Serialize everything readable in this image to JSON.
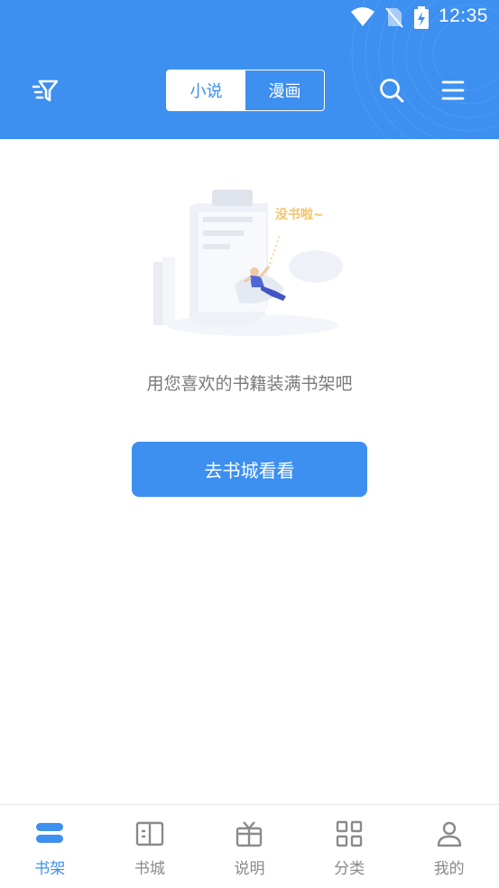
{
  "status_bar": {
    "time": "12:35",
    "icons": [
      "wifi-icon",
      "no-sim-icon",
      "battery-charging-icon"
    ]
  },
  "header": {
    "filter_icon": "filter-icon",
    "tabs": [
      {
        "label": "小说",
        "active": true
      },
      {
        "label": "漫画",
        "active": false
      }
    ],
    "search_icon": "search-icon",
    "menu_icon": "menu-icon"
  },
  "empty_state": {
    "illustration_caption": "没书啦~",
    "message": "用您喜欢的书籍装满书架吧",
    "button_label": "去书城看看"
  },
  "bottom_nav": {
    "items": [
      {
        "label": "书架",
        "icon": "bookshelf-icon",
        "active": true
      },
      {
        "label": "书城",
        "icon": "open-book-icon",
        "active": false
      },
      {
        "label": "说明",
        "icon": "gift-icon",
        "active": false
      },
      {
        "label": "分类",
        "icon": "grid-icon",
        "active": false
      },
      {
        "label": "我的",
        "icon": "user-icon",
        "active": false
      }
    ]
  },
  "colors": {
    "primary": "#3d8ff0",
    "text_gray": "#7a7a7a",
    "nav_inactive": "#8a8a8a"
  }
}
